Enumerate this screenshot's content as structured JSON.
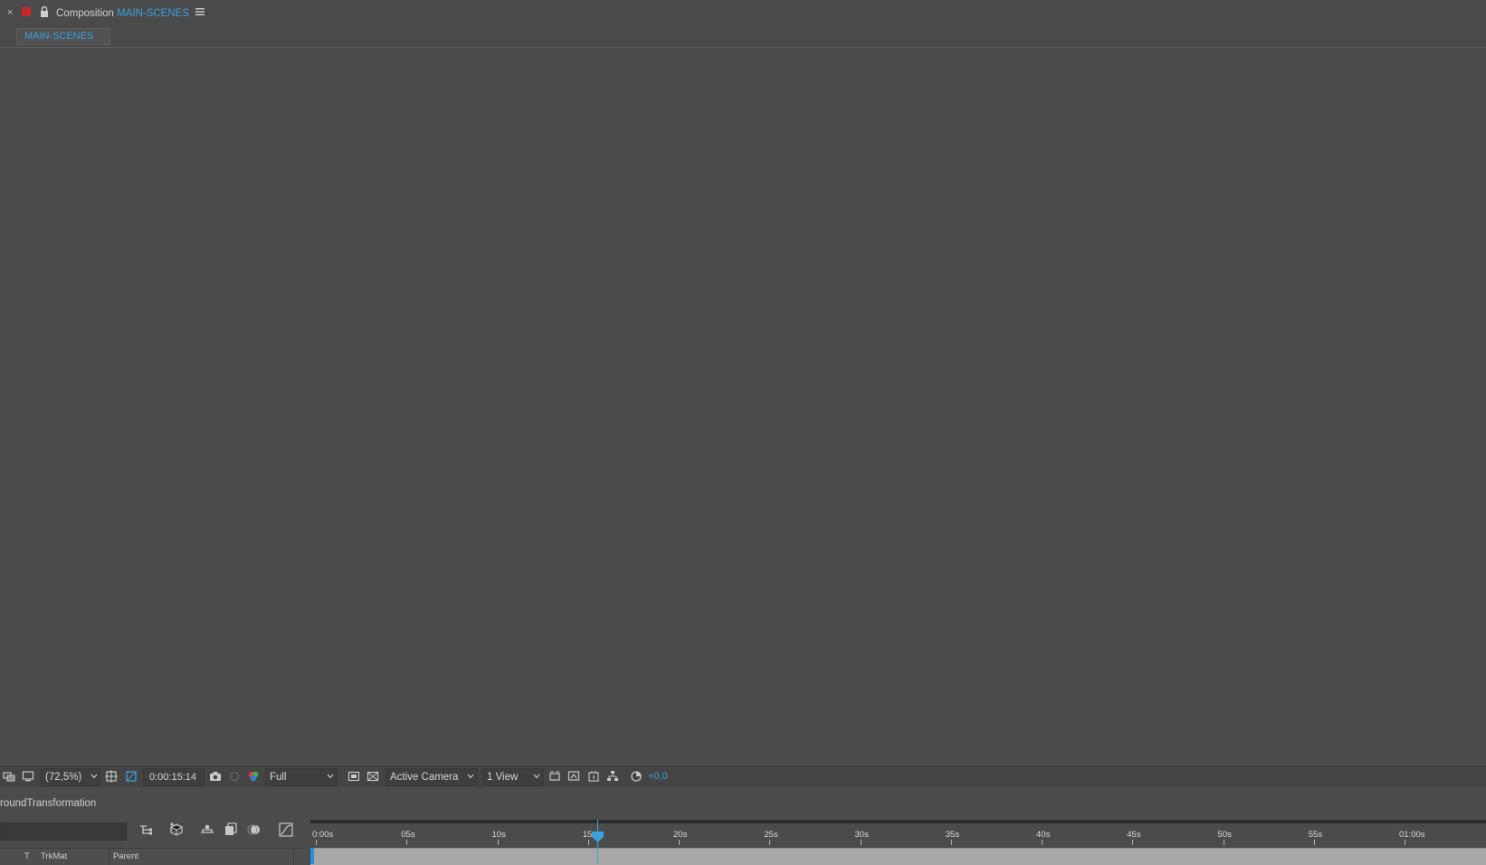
{
  "panel": {
    "close_glyph": "×",
    "title_prefix": "Composition",
    "title_comp": "MAIN-SCENES",
    "menu_icon": "hamburger-menu-icon",
    "lock_icon": "lock-icon",
    "color_label": "#c8262d"
  },
  "tabs": [
    {
      "label": "MAIN-SCENES",
      "active": true
    }
  ],
  "viewer": {
    "background": "#4b4b4b"
  },
  "toolbar": {
    "zoom": "(72,5%)",
    "timecode": "0:00:15:14",
    "resolution": "Full",
    "camera": "Active Camera",
    "views": "1 View",
    "exposure": "+0,0",
    "icons": [
      "always-preview-icon",
      "monitor-icon",
      "region-of-interest-icon",
      "transparency-grid-icon",
      "snapshot-camera-icon",
      "show-snapshot-icon",
      "color-channels-icon",
      "fast-previews-icon",
      "toggle-transparency-icon",
      "3d-draft-icon",
      "flowchart-icon",
      "reset-exposure-icon"
    ]
  },
  "timeline": {
    "comp_name": "roundTransformation",
    "columns": {
      "t": "T",
      "trkmat": "TrkMat",
      "parent": "Parent"
    },
    "ruler_labels": [
      "0:00s",
      "05s",
      "10s",
      "15s",
      "20s",
      "25s",
      "30s",
      "35s",
      "40s",
      "45s",
      "50s",
      "55s",
      "01:00s"
    ],
    "current_time_s": 15.5,
    "accent": "#3aa0e0",
    "icons": [
      "comp-flowchart-icon",
      "draft-3d-icon",
      "shy-layers-icon",
      "frame-blending-icon",
      "motion-blur-icon",
      "graph-editor-icon"
    ]
  }
}
